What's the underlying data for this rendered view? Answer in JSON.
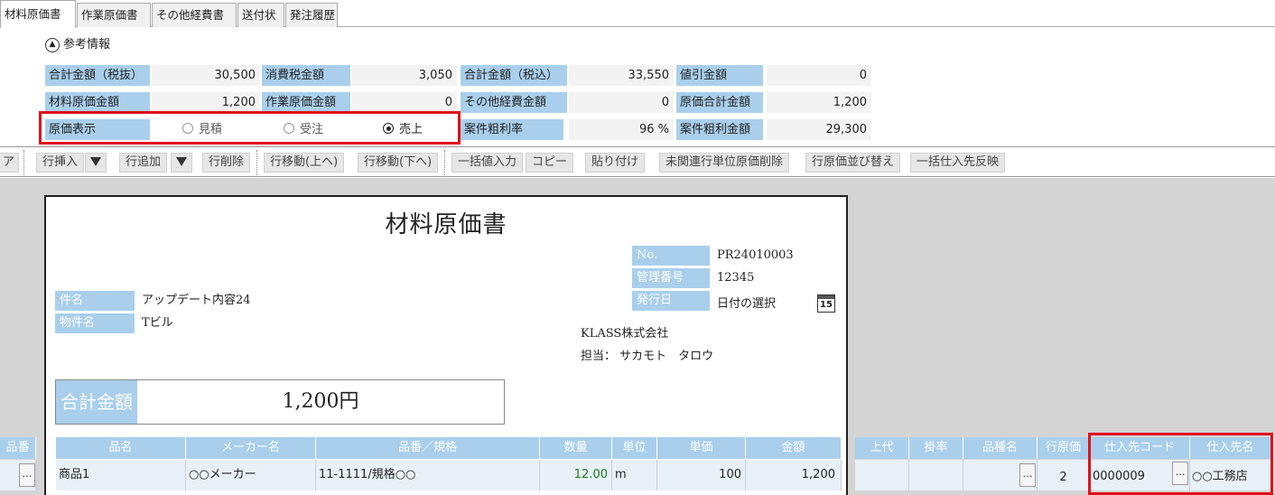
{
  "tabs": [
    {
      "label": "材料原価書",
      "active": true
    },
    {
      "label": "作業原価書"
    },
    {
      "label": "その他経費書"
    },
    {
      "label": "送付状"
    },
    {
      "label": "発注履歴"
    }
  ],
  "reference": {
    "header": "参考情報",
    "rows": [
      [
        {
          "label": "合計金額（税抜）",
          "value": "30,500"
        },
        {
          "label": "消費税金額",
          "value": "3,050"
        },
        {
          "label": "合計金額（税込）",
          "value": "33,550"
        },
        {
          "label": "値引金額",
          "value": "0"
        }
      ],
      [
        {
          "label": "材料原価金額",
          "value": "1,200"
        },
        {
          "label": "作業原価金額",
          "value": "0"
        },
        {
          "label": "その他経費金額",
          "value": "0"
        },
        {
          "label": "原価合計金額",
          "value": "1,200"
        }
      ]
    ],
    "cost_display_label": "原価表示",
    "cost_options": [
      "見積",
      "受注",
      "売上"
    ],
    "cost_selected": "売上",
    "margin_rate_label": "案件粗利率",
    "margin_rate_value": "96 %",
    "margin_amount_label": "案件粗利金額",
    "margin_amount_value": "29,300"
  },
  "toolbar": {
    "partial_left": "ア",
    "insert_row": "行挿入",
    "add_row": "行追加",
    "delete_row": "行削除",
    "move_up": "行移動(上へ)",
    "move_down": "行移動(下へ)",
    "bulk_input": "一括値入力",
    "copy": "コピー",
    "paste": "貼り付け",
    "delete_unrelated": "未関連行単位原価削除",
    "sort_cost": "行原価並び替え",
    "bulk_supplier": "一括仕入先反映"
  },
  "document": {
    "title": "材料原価書",
    "no_label": "No.",
    "no_value": "PR24010003",
    "mgmt_label": "管理番号",
    "mgmt_value": "12345",
    "issue_label": "発行日",
    "issue_value": "日付の選択",
    "calendar_day": "15",
    "subject_label": "件名",
    "subject_value": "アップデート内容24",
    "property_label": "物件名",
    "property_value": "Tビル",
    "company": "KLASS株式会社",
    "person_label": "担当：",
    "person_value": "サカモト　タロウ",
    "total_label": "合計金額",
    "total_value": "1,200円"
  },
  "grid": {
    "left_partial_header": "品番",
    "headers": [
      "品名",
      "メーカー名",
      "品番／規格",
      "数量",
      "単位",
      "単価",
      "金額"
    ],
    "row": {
      "name": "商品1",
      "maker": "○○メーカー",
      "spec": "11-1111/規格○○",
      "qty": "12.00",
      "unit": "m",
      "price": "100",
      "amount": "1,200"
    },
    "right_headers": [
      "上代",
      "掛率",
      "品種名",
      "行原価",
      "仕入先コード",
      "仕入先名"
    ],
    "right_row": {
      "row_cost": "2",
      "supplier_code": "0000009",
      "supplier_name": "○○工務店"
    },
    "ellipsis": "…"
  }
}
